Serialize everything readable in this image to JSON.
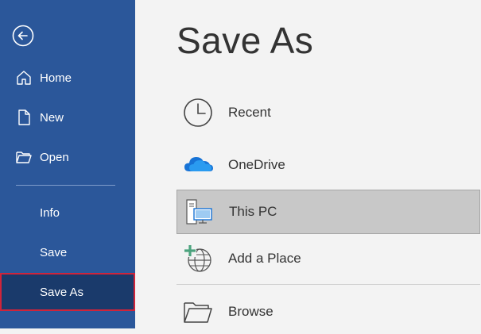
{
  "sidebar": {
    "back": {
      "icon": "back-arrow-icon"
    },
    "items": [
      {
        "label": "Home",
        "icon": "home-icon"
      },
      {
        "label": "New",
        "icon": "new-document-icon"
      },
      {
        "label": "Open",
        "icon": "open-folder-icon"
      },
      {
        "label": "Info"
      },
      {
        "label": "Save"
      },
      {
        "label": "Save As"
      }
    ],
    "selected": "Save As"
  },
  "main": {
    "title": "Save As",
    "locations": [
      {
        "label": "Recent",
        "icon": "clock-icon"
      },
      {
        "label": "OneDrive",
        "icon": "onedrive-cloud-icon"
      },
      {
        "label": "This PC",
        "icon": "this-pc-icon"
      },
      {
        "label": "Add a Place",
        "icon": "add-place-globe-icon"
      },
      {
        "label": "Browse",
        "icon": "folder-icon"
      }
    ],
    "selected_location": "This PC"
  },
  "colors": {
    "sidebar_bg": "#2b579a",
    "selected_nav_bg": "#1a3a6b",
    "selected_outline": "#d0243a",
    "main_bg": "#f3f3f3",
    "selected_location_bg": "#c8c8c8"
  }
}
